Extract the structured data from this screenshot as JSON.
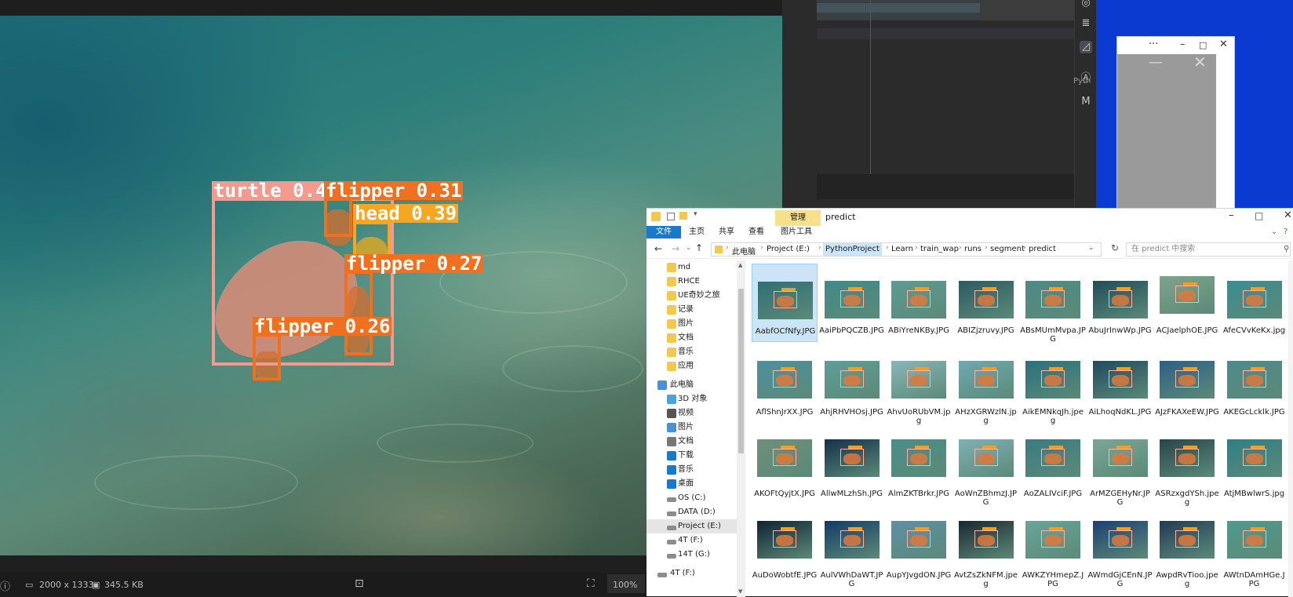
{
  "viewer": {
    "detections": [
      {
        "label": "turtle 0.48",
        "color": "#f29a8e"
      },
      {
        "label": "flipper 0.31",
        "color": "#f07020"
      },
      {
        "label": "head 0.39",
        "color": "#f5a623"
      },
      {
        "label": "flipper 0.27",
        "color": "#f07020"
      },
      {
        "label": "flipper 0.26",
        "color": "#f07020"
      }
    ],
    "status": {
      "dimensions": "2000 x 1333",
      "filesize": "345.5 KB",
      "zoom": "100%"
    }
  },
  "editor": {
    "side_label": "Pyth"
  },
  "explorer": {
    "title": "predict",
    "manage_tab": "管理",
    "ribbon_tabs": [
      "文件",
      "主页",
      "共享",
      "查看",
      "图片工具"
    ],
    "address_path": [
      "此电脑",
      "Project (E:)",
      "PythonProject",
      "Learn",
      "train_wap",
      "runs",
      "segment",
      "predict"
    ],
    "search_placeholder": "在 predict 中搜索",
    "nav_items": [
      {
        "label": "md",
        "icon": "folder-icon"
      },
      {
        "label": "RHCE",
        "icon": "folder-icon"
      },
      {
        "label": "UE奇妙之旅",
        "icon": "folder-icon"
      },
      {
        "label": "记录",
        "icon": "folder-icon"
      },
      {
        "label": "图片",
        "icon": "folder-icon"
      },
      {
        "label": "文档",
        "icon": "folder-icon"
      },
      {
        "label": "音乐",
        "icon": "folder-icon"
      },
      {
        "label": "应用",
        "icon": "folder-icon"
      },
      {
        "label": "此电脑",
        "icon": "computer-icon"
      },
      {
        "label": "3D 对象",
        "icon": "cube-icon"
      },
      {
        "label": "视频",
        "icon": "video-icon"
      },
      {
        "label": "图片",
        "icon": "picture-icon"
      },
      {
        "label": "文档",
        "icon": "document-icon"
      },
      {
        "label": "下载",
        "icon": "download-icon"
      },
      {
        "label": "音乐",
        "icon": "music-icon"
      },
      {
        "label": "桌面",
        "icon": "desktop-icon"
      },
      {
        "label": "OS (C:)",
        "icon": "drive-icon"
      },
      {
        "label": "DATA (D:)",
        "icon": "drive-icon"
      },
      {
        "label": "Project (E:)",
        "icon": "drive-icon"
      },
      {
        "label": "4T (F:)",
        "icon": "drive-icon"
      },
      {
        "label": "14T (G:)",
        "icon": "drive-icon"
      },
      {
        "label": "4T (F:)",
        "icon": "drive-icon"
      }
    ],
    "files": [
      "AabfOCfNfy.JPG",
      "AaiPbPQCZB.JPG",
      "ABiYreNKBy.JPG",
      "ABIZjzruvy.JPG",
      "ABsMUmMvpa.JPG",
      "AbuJrInwWp.JPG",
      "ACJaelphOE.JPG",
      "AfeCVvKeKx.jpg",
      "AflShnJrXX.JPG",
      "AhjRHVHOsj.JPG",
      "AhvUoRUbVM.jpg",
      "AHzXGRWzlN.jpg",
      "AikEMNkqJh.jpeg",
      "AiLhoqNdKL.JPG",
      "AJzFKAXeEW.JPG",
      "AKEGcLcklk.JPG",
      "AKOFtQyjtX.JPG",
      "AllwMLzhSh.JPG",
      "AlmZKTBrkr.JPG",
      "AoWnZBhmzJ.JPG",
      "AoZALIVciF.JPG",
      "ArMZGEHyNr.JPG",
      "ASRzxgdYSh.jpeg",
      "AtjMBwlwrS.jpg",
      "AuDoWobtfE.JPG",
      "AulVWhDaWT.JPG",
      "AupYJvgdON.JPG",
      "AvtZsZkNFM.jpeg",
      "AWKZYHmepZ.JPG",
      "AWmdGjCEnN.JPG",
      "AwpdRvTioo.jpeg",
      "AWtnDAmHGe.JPG"
    ],
    "thumb_colors": [
      "#2f6f74",
      "#3f8a88",
      "#5e9a94",
      "#2c5a63",
      "#4d8a85",
      "#1f4d5a",
      "#7fa38c",
      "#3b8c92",
      "#4f8fa0",
      "#5f9d98",
      "#8ab6b8",
      "#6fa9b0",
      "#2c6f7c",
      "#1f4a5e",
      "#2d5f86",
      "#4e8a8c",
      "#6e8f7a",
      "#13304a",
      "#4a8d8a",
      "#7fb1b4",
      "#3b7b82",
      "#7aa696",
      "#27454a",
      "#2f7f86",
      "#0f2233",
      "#123b66",
      "#5f8fa5",
      "#1a2630",
      "#6aa49a",
      "#1c3f73",
      "#223b55",
      "#4f9a8e"
    ]
  }
}
